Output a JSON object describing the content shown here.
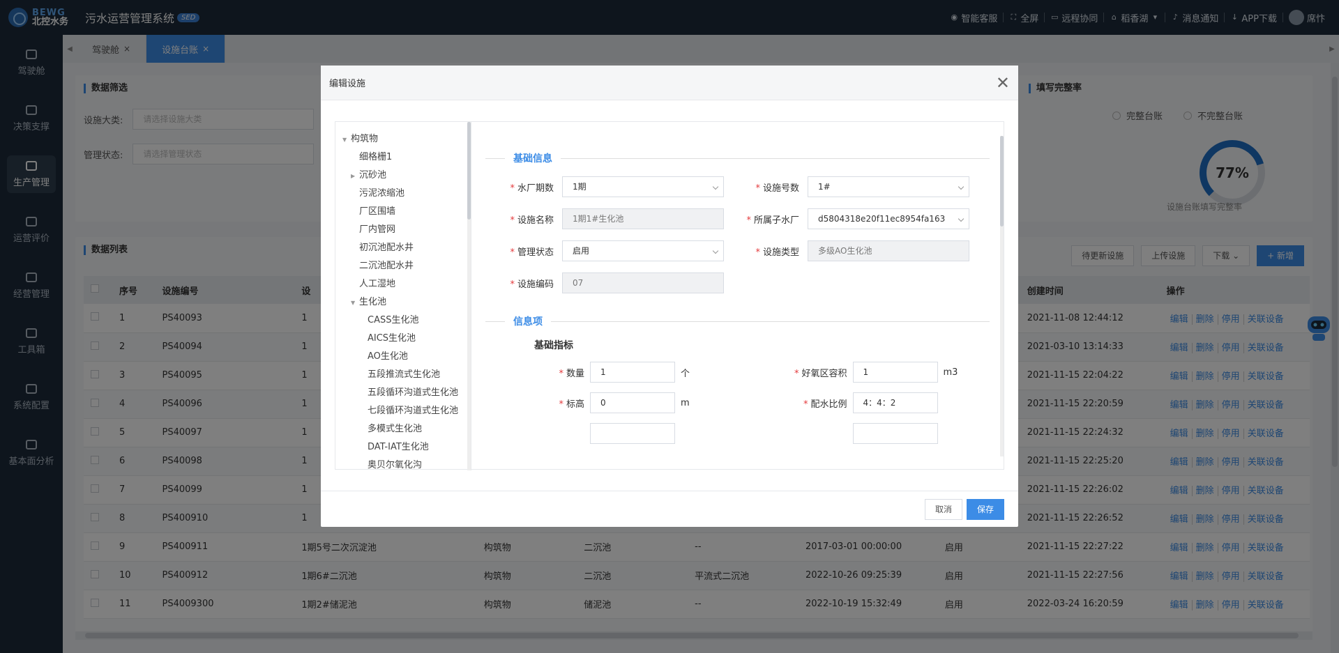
{
  "header": {
    "logo_en": "BEWG",
    "logo_cn": "北控水务",
    "system_title": "污水运营管理系统",
    "system_badge": "SED",
    "items": [
      {
        "label": "智能客服",
        "icon": "headset-icon"
      },
      {
        "label": "全屏",
        "icon": "fullscreen-icon"
      },
      {
        "label": "远程协同",
        "icon": "remote-icon"
      },
      {
        "label": "稻香湖",
        "icon": "home-icon"
      },
      {
        "label": "消息通知",
        "icon": "bell-icon"
      },
      {
        "label": "APP下载",
        "icon": "download-icon"
      }
    ],
    "user": "席忭"
  },
  "sidebar": {
    "items": [
      {
        "label": "驾驶舱",
        "icon": "dashboard-icon"
      },
      {
        "label": "决策支撑",
        "icon": "decision-icon"
      },
      {
        "label": "生产管理",
        "icon": "factory-icon",
        "active": true
      },
      {
        "label": "运营评价",
        "icon": "chart-icon"
      },
      {
        "label": "经营管理",
        "icon": "briefcase-icon"
      },
      {
        "label": "工具箱",
        "icon": "toolbox-icon"
      },
      {
        "label": "系统配置",
        "icon": "settings-icon"
      },
      {
        "label": "基本面分析",
        "icon": "analysis-icon"
      }
    ]
  },
  "tabs": [
    {
      "label": "驾驶舱",
      "active": false
    },
    {
      "label": "设施台账",
      "active": true
    }
  ],
  "filter": {
    "title": "数据筛选",
    "category_label": "设施大类:",
    "category_placeholder": "请选择设施大类",
    "status_label": "管理状态:",
    "status_placeholder": "请选择管理状态"
  },
  "completeness": {
    "title": "填写完整率",
    "opt1": "完整台账",
    "opt2": "不完整台账",
    "percent_text": "77%",
    "percent": 77,
    "label": "设施台账填写完整率"
  },
  "list": {
    "title": "数据列表",
    "buttons": {
      "pending": "待更新设施",
      "upload": "上传设施",
      "download": "下载",
      "add": "+ 新增"
    },
    "columns": [
      "序号",
      "设施编号",
      "设",
      "",
      "",
      "",
      "",
      "",
      "创建时间",
      "操作"
    ],
    "ops": [
      "编辑",
      "删除",
      "停用",
      "关联设备"
    ],
    "rows": [
      [
        "1",
        "PS40093",
        "1",
        "",
        "",
        "",
        "",
        "",
        "2021-11-08 12:44:12"
      ],
      [
        "2",
        "PS40094",
        "1",
        "",
        "",
        "",
        "",
        "",
        "2021-03-10 13:14:33"
      ],
      [
        "3",
        "PS40095",
        "1",
        "",
        "",
        "",
        "",
        "",
        "2021-11-15 22:04:22"
      ],
      [
        "4",
        "PS40096",
        "1",
        "",
        "",
        "",
        "",
        "",
        "2021-11-15 22:20:59"
      ],
      [
        "5",
        "PS40097",
        "1",
        "",
        "",
        "",
        "",
        "",
        "2021-11-15 22:24:32"
      ],
      [
        "6",
        "PS40098",
        "1",
        "",
        "",
        "",
        "",
        "",
        "2021-11-15 22:25:20"
      ],
      [
        "7",
        "PS40099",
        "1",
        "",
        "",
        "",
        "",
        "",
        "2021-11-15 22:26:02"
      ],
      [
        "8",
        "PS400910",
        "1",
        "",
        "",
        "",
        "",
        "",
        "2021-11-15 22:26:52"
      ],
      [
        "9",
        "PS400911",
        "1期5号二次沉淀池",
        "构筑物",
        "二沉池",
        "--",
        "2017-03-01 00:00:00",
        "启用",
        "2021-11-15 22:27:22"
      ],
      [
        "10",
        "PS400912",
        "1期6#二沉池",
        "构筑物",
        "二沉池",
        "平流式二沉池",
        "2022-10-26 09:25:39",
        "启用",
        "2021-11-15 22:27:56"
      ],
      [
        "11",
        "PS4009300",
        "1期2#储泥池",
        "构筑物",
        "储泥池",
        "--",
        "2022-10-19 15:32:49",
        "启用",
        "2022-03-24 16:20:59"
      ]
    ]
  },
  "modal": {
    "title": "编辑设施",
    "tree": [
      {
        "label": "构筑物",
        "level": 0,
        "caret": "down"
      },
      {
        "label": "细格栅1",
        "level": 1,
        "caret": ""
      },
      {
        "label": "沉砂池",
        "level": 1,
        "caret": "right"
      },
      {
        "label": "污泥浓缩池",
        "level": 1,
        "caret": ""
      },
      {
        "label": "厂区围墙",
        "level": 1,
        "caret": ""
      },
      {
        "label": "厂内管网",
        "level": 1,
        "caret": ""
      },
      {
        "label": "初沉池配水井",
        "level": 1,
        "caret": ""
      },
      {
        "label": "二沉池配水井",
        "level": 1,
        "caret": ""
      },
      {
        "label": "人工湿地",
        "level": 1,
        "caret": ""
      },
      {
        "label": "生化池",
        "level": 1,
        "caret": "down"
      },
      {
        "label": "CASS生化池",
        "level": 2,
        "caret": ""
      },
      {
        "label": "AICS生化池",
        "level": 2,
        "caret": ""
      },
      {
        "label": "AO生化池",
        "level": 2,
        "caret": ""
      },
      {
        "label": "五段推流式生化池",
        "level": 2,
        "caret": ""
      },
      {
        "label": "五段循环沟道式生化池",
        "level": 2,
        "caret": ""
      },
      {
        "label": "七段循环沟道式生化池",
        "level": 2,
        "caret": ""
      },
      {
        "label": "多模式生化池",
        "level": 2,
        "caret": ""
      },
      {
        "label": "DAT-IAT生化池",
        "level": 2,
        "caret": ""
      },
      {
        "label": "奥贝尔氧化沟",
        "level": 2,
        "caret": ""
      }
    ],
    "section_basic": "基础信息",
    "fields": {
      "phase_label": "水厂期数",
      "phase_value": "1期",
      "number_label": "设施号数",
      "number_value": "1#",
      "name_label": "设施名称",
      "name_value": "1期1#生化池",
      "plant_label": "所属子水厂",
      "plant_value": "d5804318e20f11ec8954fa163",
      "status_label": "管理状态",
      "status_value": "启用",
      "type_label": "设施类型",
      "type_value": "多级AO生化池",
      "code_label": "设施编码",
      "code_value": "07"
    },
    "section_info": "信息项",
    "subhead": "基础指标",
    "indicators": {
      "qty_label": "数量",
      "qty_value": "1",
      "qty_unit": "个",
      "vol_label": "好氧区容积",
      "vol_value": "1",
      "vol_unit": "m3",
      "elev_label": "标高",
      "elev_value": "0",
      "elev_unit": "m",
      "ratio_label": "配水比例",
      "ratio_value": "4：4：2"
    },
    "cancel": "取消",
    "save": "保存"
  },
  "colors": {
    "accent": "#3c8ce6",
    "topbar": "#1d2b3a",
    "required": "#e4393c"
  }
}
